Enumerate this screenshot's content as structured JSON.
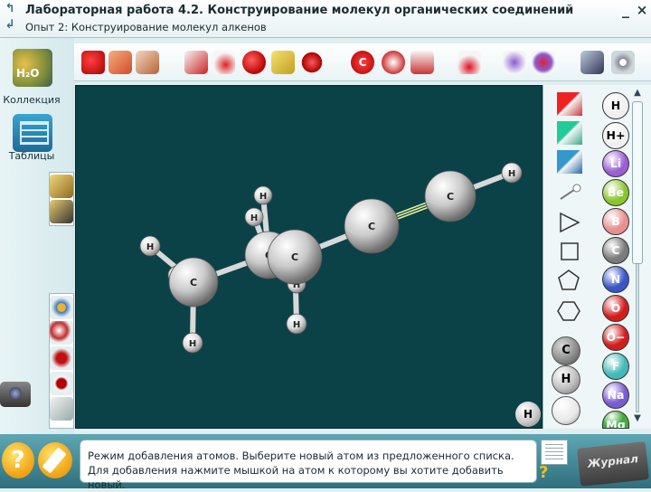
{
  "window": {
    "title": "Лабораторная работа 4.2. Конструирование молекул органических соединений",
    "subtitle": "Опыт 2: Конструирование молекул алкенов",
    "minimize": "_",
    "close": "×",
    "nav_up": "↰",
    "nav_back": "↲"
  },
  "sidebar": {
    "collection_label": "Коллекция",
    "collection_badge": "H₂O",
    "tables_label": "Таблицы"
  },
  "toolbar_icons": [
    "pointer-icon",
    "hand-icon",
    "eraser-icon",
    "bond-angle-icon",
    "atom-link-icon",
    "red-ball-icon",
    "scissors-icon",
    "capsule-icon",
    "carbon-c-icon",
    "partial-charge-icon",
    "stretch-icon",
    "flask-icon",
    "minus-delta-icon",
    "plus-delta-icon",
    "gallery-icon",
    "gear-icon"
  ],
  "molecule": {
    "atoms": [
      {
        "label": "C",
        "role": "carbon"
      },
      {
        "label": "C",
        "role": "carbon"
      },
      {
        "label": "C",
        "role": "carbon"
      },
      {
        "label": "C",
        "role": "carbon"
      },
      {
        "label": "C",
        "role": "carbon"
      },
      {
        "label": "H",
        "role": "hydrogen"
      },
      {
        "label": "H",
        "role": "hydrogen"
      },
      {
        "label": "H",
        "role": "hydrogen"
      },
      {
        "label": "H",
        "role": "hydrogen"
      },
      {
        "label": "H",
        "role": "hydrogen"
      },
      {
        "label": "H",
        "role": "hydrogen"
      },
      {
        "label": "H",
        "role": "hydrogen"
      },
      {
        "label": "H",
        "role": "hydrogen"
      }
    ],
    "triple_bond": "C≡C"
  },
  "corner_atom": "H",
  "right_panel": {
    "tools": [
      "bond-red-icon",
      "bond-green-icon",
      "bond-blue-icon",
      "bond-single-icon"
    ],
    "shapes": [
      "triangle-icon",
      "square-icon",
      "pentagon-icon",
      "hexagon-icon"
    ],
    "preview_atoms": [
      "C",
      "H",
      ""
    ],
    "elements": [
      {
        "symbol": "H",
        "color": "#f0f0f0",
        "text": "#000000"
      },
      {
        "symbol": "H+",
        "color": "#f0f0f0",
        "text": "#000000"
      },
      {
        "symbol": "Li",
        "color": "#9b5fd4",
        "text": "#ffffff"
      },
      {
        "symbol": "Be",
        "color": "#89c62e",
        "text": "#ffffff"
      },
      {
        "symbol": "B",
        "color": "#e98f8f",
        "text": "#ffffff"
      },
      {
        "symbol": "C",
        "color": "#7b7b7b",
        "text": "#ffffff"
      },
      {
        "symbol": "N",
        "color": "#3a55c8",
        "text": "#ffffff"
      },
      {
        "symbol": "O",
        "color": "#d21d1d",
        "text": "#ffffff"
      },
      {
        "symbol": "O−",
        "color": "#d21d1d",
        "text": "#ffffff"
      },
      {
        "symbol": "F",
        "color": "#44b8b8",
        "text": "#ffffff"
      },
      {
        "symbol": "Na",
        "color": "#7a5bd0",
        "text": "#ffffff"
      },
      {
        "symbol": "Mg",
        "color": "#3fae3f",
        "text": "#ffffff"
      }
    ]
  },
  "status": {
    "message": "Режим добавления атомов. Выберите новый атом из предложенного списка. Для добавления нажмите мышкой на атом к которому вы хотите добавить новый."
  },
  "bottom": {
    "help": "?",
    "doc_q": "?",
    "journal": "Журнал"
  },
  "colors": {
    "viewport_bg": "#0a4248",
    "accent": "#2b6f86",
    "bond_triple": "#e6ef9a"
  }
}
